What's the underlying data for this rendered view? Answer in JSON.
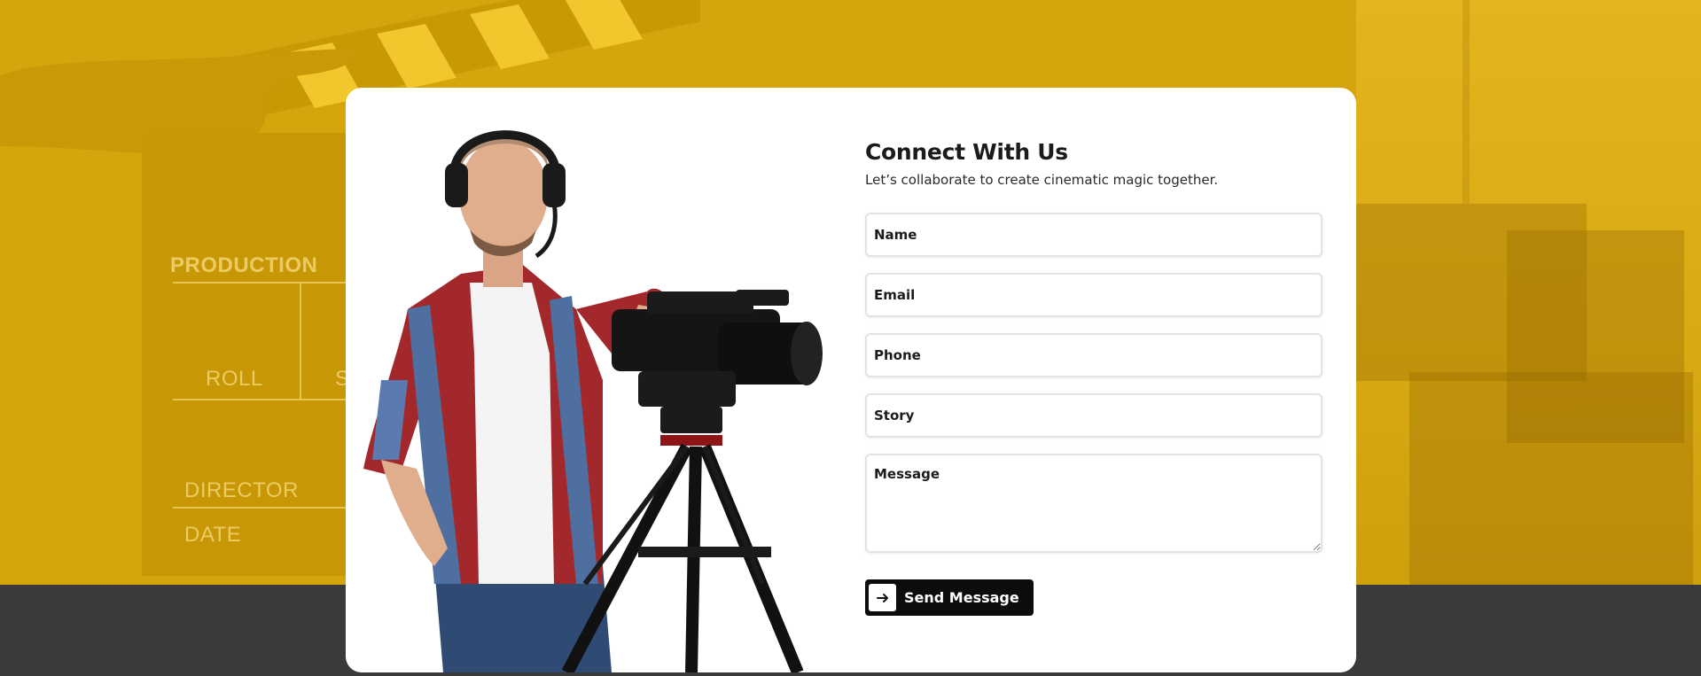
{
  "background": {
    "board_labels": [
      "PRODUCTION",
      "ROLL",
      "S",
      "DIRECTOR",
      "DATE"
    ],
    "colors": {
      "hero": "#d6a40c",
      "footer": "#3a3a3c"
    }
  },
  "contact": {
    "title": "Connect With Us",
    "subtitle": "Let’s collaborate to create cinematic magic together.",
    "fields": {
      "name": {
        "placeholder": "Name",
        "value": ""
      },
      "email": {
        "placeholder": "Email",
        "value": ""
      },
      "phone": {
        "placeholder": "Phone",
        "value": ""
      },
      "story": {
        "placeholder": "Story",
        "value": ""
      },
      "message": {
        "placeholder": "Message",
        "value": ""
      }
    },
    "send_label": "Send Message",
    "send_icon": "arrow-right-icon"
  }
}
